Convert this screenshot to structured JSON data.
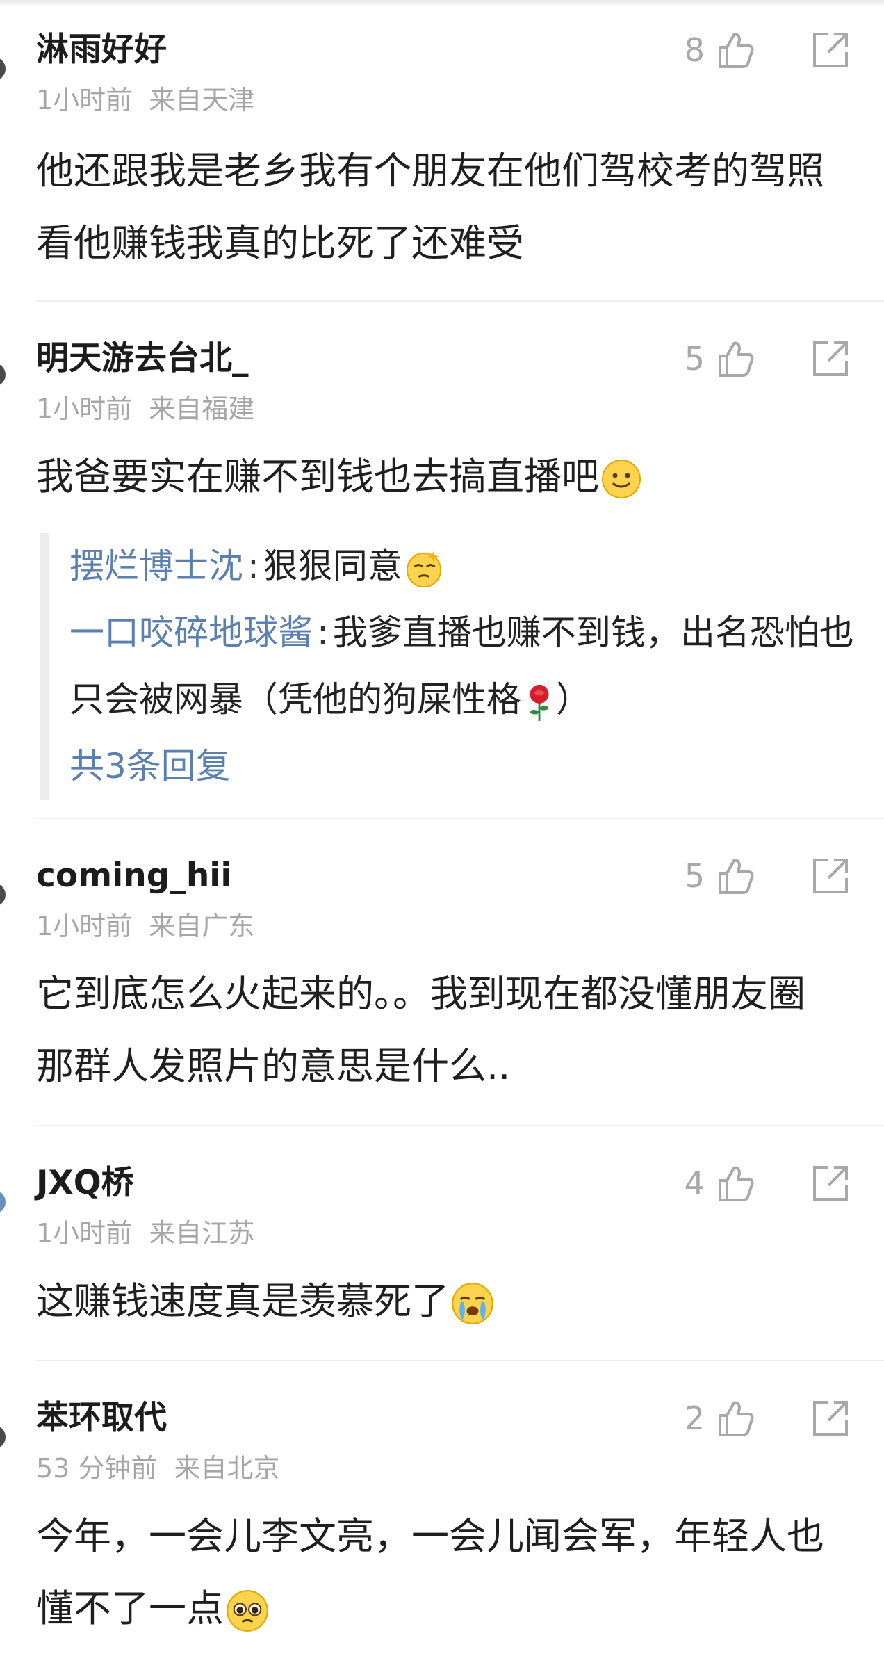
{
  "comments": [
    {
      "username": "淋雨好好",
      "time": "1小时前",
      "location": "来自天津",
      "likes": "8",
      "text": "他还跟我是老乡我有个朋友在他们驾校考的驾照 看他赚钱我真的比死了还难受"
    },
    {
      "username": "明天游去台北_",
      "time": "1小时前",
      "location": "来自福建",
      "likes": "5",
      "text": "我爸要实在赚不到钱也去搞直播吧",
      "emoji": "slightly-smiling-face-icon",
      "replies": [
        {
          "name": "摆烂博士沈",
          "sep": ":",
          "text": "狠狠同意",
          "emoji": "dizzy-face-icon"
        },
        {
          "name": "一口咬碎地球酱",
          "sep": ":",
          "text": "我爹直播也赚不到钱，出名恐怕也只会被网暴（凭他的狗屎性格",
          "emoji": "rose-icon",
          "tail": "）"
        }
      ],
      "more_replies": "共3条回复"
    },
    {
      "username": "coming_hii",
      "time": "1小时前",
      "location": "来自广东",
      "likes": "5",
      "text": "它到底怎么火起来的。。我到现在都没懂朋友圈那群人发照片的意思是什么.."
    },
    {
      "username": "JXQ桥",
      "time": "1小时前",
      "location": "来自江苏",
      "likes": "4",
      "text": "这赚钱速度真是羡慕死了",
      "emoji": "crying-face-icon"
    },
    {
      "username": "苯环取代",
      "time": "53 分钟前",
      "location": "来自北京",
      "likes": "2",
      "text": "今年，一会儿李文亮，一会儿闻会军，年轻人也懂不了一点",
      "emoji": "pleading-face-icon"
    }
  ],
  "colors": {
    "link": "#5a7fb0",
    "meta": "#a6a6a6",
    "icon": "#a8a8a8"
  }
}
